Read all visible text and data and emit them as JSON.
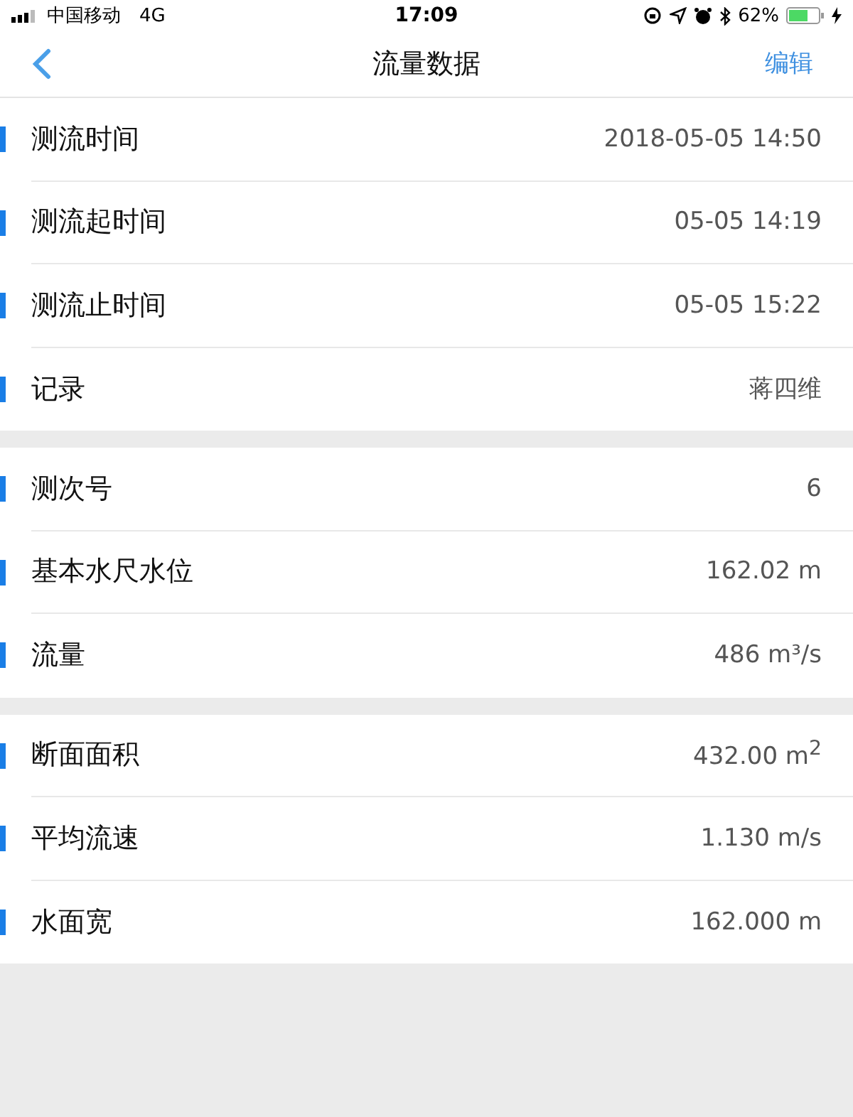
{
  "status_bar": {
    "carrier": "中国移动",
    "network": "4G",
    "time": "17:09",
    "battery": "62%"
  },
  "nav": {
    "title": "流量数据",
    "action": "编辑"
  },
  "sections": [
    {
      "rows": [
        {
          "label": "测流时间",
          "value": "2018-05-05 14:50"
        },
        {
          "label": "测流起时间",
          "value": "05-05 14:19"
        },
        {
          "label": "测流止时间",
          "value": "05-05 15:22"
        },
        {
          "label": "记录",
          "value": "蒋四维"
        }
      ]
    },
    {
      "rows": [
        {
          "label": "测次号",
          "value": "6"
        },
        {
          "label": "基本水尺水位",
          "value": "162.02 m"
        },
        {
          "label": "流量",
          "value": "486 m³/s"
        }
      ]
    },
    {
      "rows": [
        {
          "label": "断面面积",
          "value": "432.00 m$^{2}$"
        },
        {
          "label": "平均流速",
          "value": "1.130 m/s"
        },
        {
          "label": "水面宽",
          "value": "162.000 m"
        }
      ]
    }
  ]
}
